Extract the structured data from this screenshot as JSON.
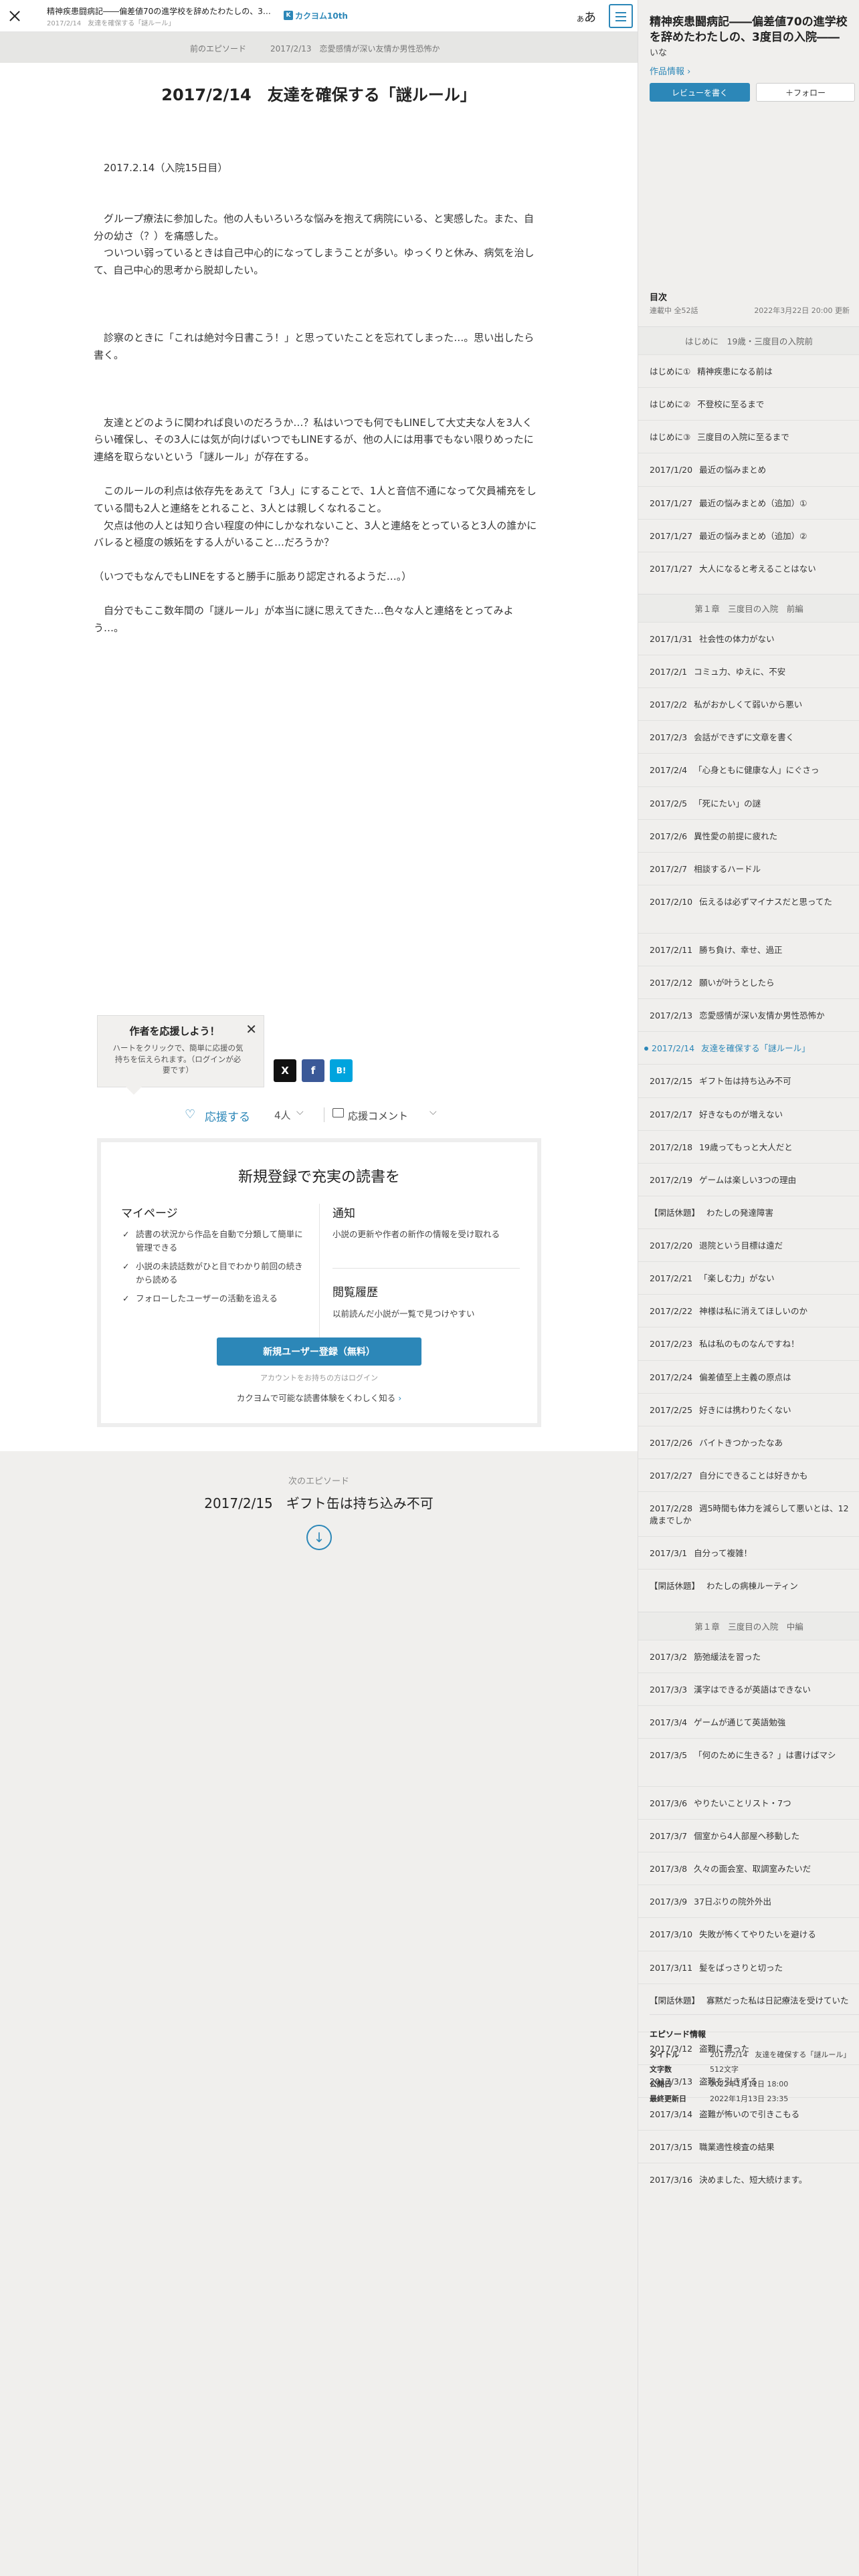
{
  "header": {
    "work_title": "精神疾患闘病記――偏差値70の進学校を辞めたわたしの、3度目の入院――",
    "episode_title": "2017/2/14　友達を確保する「謎ルール」",
    "logo_mark": "K",
    "logo_text": "カクヨム10th",
    "font_button": "あ",
    "font_button_small": "あ"
  },
  "nav": {
    "prev_label": "前のエピソード",
    "prev_title": "2017/2/13　恋愛感情が深い友情か男性恐怖か"
  },
  "episode": {
    "title": "2017/2/14　友達を確保する「謎ルール」",
    "paragraphs": [
      "",
      "　2017.2.14（入院15日目）",
      "",
      "",
      "　グループ療法に参加した。他の人もいろいろな悩みを抱えて病院にいる、と実感した。また、自分の幼さ（？）を痛感した。",
      "　ついつい弱っているときは自己中心的になってしまうことが多い。ゆっくりと休み、病気を治して、自己中心的思考から脱却したい。",
      "",
      "",
      "",
      "　診察のときに「これは絶対今日書こう！」と思っていたことを忘れてしまった…。思い出したら書く。",
      "",
      "",
      "",
      "　友達とどのように関われば良いのだろうか…？私はいつでも何でもLINEして大丈夫な人を3人くらい確保し、その3人には気が向けばいつでもLINEするが、他の人には用事でもない限りめったに連絡を取らないという「謎ルール」が存在する。",
      "",
      "　このルールの利点は依存先をあえて「3人」にすることで、1人と音信不通になって欠員補充をしている間も2人と連絡をとれること、3人とは親しくなれること。",
      "　欠点は他の人とは知り合い程度の仲にしかなれないこと、3人と連絡をとっていると3人の誰かにバレると極度の嫉妬をする人がいること…だろうか？",
      "",
      "（いつでもなんでもLINEをすると勝手に脈あり認定されるようだ…。）",
      "",
      "　自分でもここ数年間の「謎ルール」が本当に謎に思えてきた…色々な人と連絡をとってみよう…。"
    ]
  },
  "tooltip": {
    "title": "作者を応援しよう！",
    "body": "ハートをクリックで、簡単に応援の気持ちを伝えられます。（ログインが必要です）",
    "close": "✕"
  },
  "share": {
    "x": "X",
    "facebook": "f",
    "hatena": "B!"
  },
  "support": {
    "button": "応援する",
    "count": "4人",
    "comment": "応援コメント"
  },
  "register": {
    "title": "新規登録で充実の読書を",
    "mypage_head": "マイページ",
    "mypage_items": [
      "読書の状況から作品を自動で分類して簡単に管理できる",
      "小説の未読話数がひと目でわかり前回の続きから読める",
      "フォローしたユーザーの活動を追える"
    ],
    "notice_head": "通知",
    "notice_text": "小説の更新や作者の新作の情報を受け取れる",
    "history_head": "閲覧履歴",
    "history_text": "以前読んだ小説が一覧で見つけやすい",
    "button": "新規ユーザー登録（無料）",
    "login": "アカウントをお持ちの方はログイン",
    "learn": "カクヨムで可能な読書体験をくわしく知る"
  },
  "next": {
    "label": "次のエピソード",
    "title": "2017/2/15　ギフト缶は持ち込み不可"
  },
  "sidebar": {
    "work_title": "精神疾患闘病記――偏差値70の進学校を辞めたわたしの、3度目の入院――",
    "author": "いな",
    "info_link": "作品情報",
    "review_button": "レビューを書く",
    "follow_button": "＋フォロー",
    "toc_head": "目次",
    "episode_count": "連載中 全52話",
    "updated": "2022年3月22日 20:00 更新",
    "sections": [
      {
        "chapter": "はじめに　19歳・三度目の入院前",
        "items": [
          {
            "d": "はじめに①",
            "t": "精神疾患になる前は"
          },
          {
            "d": "はじめに②",
            "t": "不登校に至るまで"
          },
          {
            "d": "はじめに③",
            "t": "三度目の入院に至るまで"
          },
          {
            "d": "2017/1/20",
            "t": "最近の悩みまとめ"
          },
          {
            "d": "2017/1/27",
            "t": "最近の悩みまとめ（追加）①"
          },
          {
            "d": "2017/1/27",
            "t": "最近の悩みまとめ（追加）②"
          },
          {
            "d": "2017/1/27",
            "t": "大人になると考えることはない"
          }
        ]
      },
      {
        "chapter": "第１章　三度目の入院　前編",
        "items": [
          {
            "d": "2017/1/31",
            "t": "社会性の体力がない"
          },
          {
            "d": "2017/2/1",
            "t": "コミュ力、ゆえに、不安"
          },
          {
            "d": "2017/2/2",
            "t": "私がおかしくて弱いから悪い"
          },
          {
            "d": "2017/2/3",
            "t": "会話ができずに文章を書く"
          },
          {
            "d": "2017/2/4",
            "t": "「心身ともに健康な人」にぐさっ"
          },
          {
            "d": "2017/2/5",
            "t": "「死にたい」の謎"
          },
          {
            "d": "2017/2/6",
            "t": "異性愛の前提に疲れた"
          },
          {
            "d": "2017/2/7",
            "t": "相談するハードル"
          },
          {
            "d": "2017/2/10",
            "t": "伝えるは必ずマイナスだと思ってた",
            "tall": true
          },
          {
            "d": "2017/2/11",
            "t": "勝ち負け、幸せ、過正"
          },
          {
            "d": "2017/2/12",
            "t": "願いが叶うとしたら"
          },
          {
            "d": "2017/2/13",
            "t": "恋愛感情が深い友情か男性恐怖か"
          },
          {
            "d": "2017/2/14",
            "t": "友達を確保する「謎ルール」",
            "current": true
          },
          {
            "d": "2017/2/15",
            "t": "ギフト缶は持ち込み不可"
          },
          {
            "d": "2017/2/17",
            "t": "好きなものが増えない"
          },
          {
            "d": "2017/2/18",
            "t": "19歳ってもっと大人だと"
          },
          {
            "d": "2017/2/19",
            "t": "ゲームは楽しい3つの理由"
          },
          {
            "d": "【閑話休題】",
            "t": "わたしの発達障害"
          },
          {
            "d": "2017/2/20",
            "t": "退院という目標は遠だ"
          },
          {
            "d": "2017/2/21",
            "t": "「楽しむ力」がない"
          },
          {
            "d": "2017/2/22",
            "t": "神様は私に消えてほしいのか"
          },
          {
            "d": "2017/2/23",
            "t": "私は私のものなんですね！"
          },
          {
            "d": "2017/2/24",
            "t": "偏差値至上主義の原点は"
          },
          {
            "d": "2017/2/25",
            "t": "好きには携わりたくない"
          },
          {
            "d": "2017/2/26",
            "t": "バイトきつかったなあ"
          },
          {
            "d": "2017/2/27",
            "t": "自分にできることは好きかも"
          },
          {
            "d": "2017/2/28",
            "t": "週5時間も体力を減らして悪いとは、12歳までしか"
          },
          {
            "d": "2017/3/1",
            "t": "自分って複雑！"
          },
          {
            "d": "【閑話休題】",
            "t": "わたしの病棟ルーティン"
          }
        ]
      },
      {
        "chapter": "第１章　三度目の入院　中編",
        "items": [
          {
            "d": "2017/3/2",
            "t": "筋弛緩法を習った"
          },
          {
            "d": "2017/3/3",
            "t": "漢字はできるが英語はできない"
          },
          {
            "d": "2017/3/4",
            "t": "ゲームが通じて英語勉強"
          },
          {
            "d": "2017/3/5",
            "t": "「何のために生きる？」は書けばマシ",
            "tall": true
          },
          {
            "d": "2017/3/6",
            "t": "やりたいことリスト・7つ"
          },
          {
            "d": "2017/3/7",
            "t": "個室から4人部屋へ移動した"
          },
          {
            "d": "2017/3/8",
            "t": "久々の面会室、取調室みたいだ"
          },
          {
            "d": "2017/3/9",
            "t": "37日ぶりの院外外出"
          },
          {
            "d": "2017/3/10",
            "t": "失敗が怖くてやりたいを避ける"
          },
          {
            "d": "2017/3/11",
            "t": "髪をばっさりと切った"
          },
          {
            "d": "【閑話休題】",
            "t": "寡黙だった私は日記療法を受けていた",
            "tall": true
          },
          {
            "d": "2017/3/12",
            "t": "盗難に遭った"
          },
          {
            "d": "2017/3/13",
            "t": "盗難を引きずる"
          },
          {
            "d": "2017/3/14",
            "t": "盗難が怖いので引きこもる"
          },
          {
            "d": "2017/3/15",
            "t": "職業適性検査の結果"
          },
          {
            "d": "2017/3/16",
            "t": "決めました、短大続けます。"
          }
        ]
      }
    ],
    "ep_info": {
      "head": "エピソード情報",
      "rows": [
        {
          "k": "タイトル",
          "v": "2017/2/14　友達を確保する「謎ルール」"
        },
        {
          "k": "文字数",
          "v": "512文字"
        },
        {
          "k": "公開日",
          "v": "2022年1月11日 18:00"
        },
        {
          "k": "最終更新日",
          "v": "2022年1月13日 23:35"
        }
      ]
    }
  },
  "colors": {
    "accent": "#2c87b8"
  }
}
